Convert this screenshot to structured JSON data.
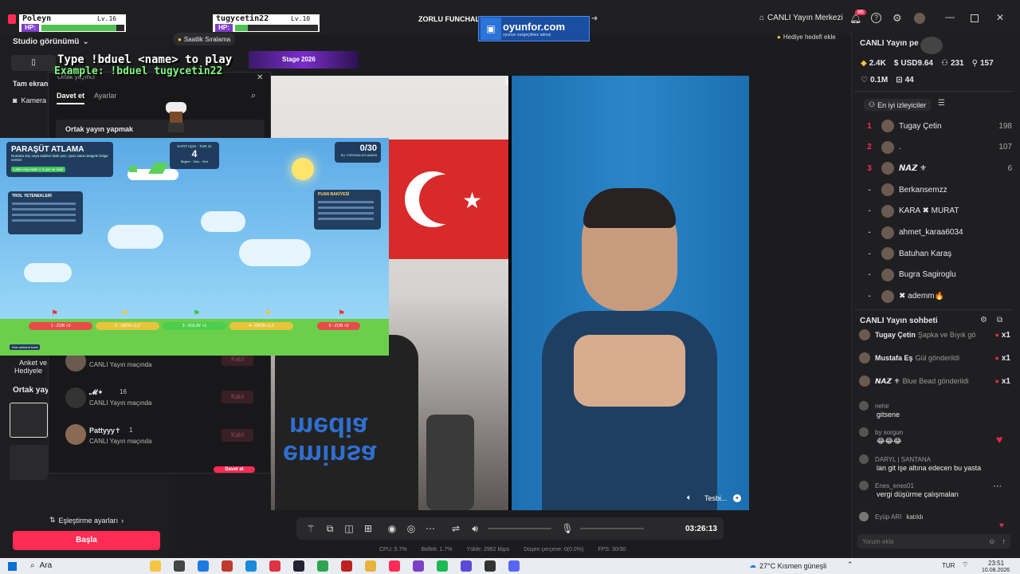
{
  "window": {
    "title": "ZORLU FUNCHAL",
    "live_center": "CANLI Yayın Merkezi",
    "notif_count": "86"
  },
  "players": [
    {
      "name": "Poleyn",
      "level": "Lv.16",
      "hp_label": "HP:",
      "hp_fraction": 0.9
    },
    {
      "name": "tugycetin22",
      "level": "Lv.10",
      "hp_label": "HP:",
      "hp_fraction": 0.15
    }
  ],
  "overlay": {
    "duel_line1": "Type !bduel <name> to play",
    "duel_line2": "Example: !bduel tugycetin22",
    "sponsor_name": "oyunfor.com",
    "sponsor_tag": "oyunun vazgeçilmez adresi",
    "hourly_rank": "Saatlik Sıralama",
    "gift_goal": "Hediye hedefi ekle",
    "stage_text": "Stage 2026"
  },
  "left_panel": {
    "studio_view": "Studio görünümü",
    "full_screen": "Tam ekran",
    "camera": "Kamera",
    "poll": "Anket ve",
    "gift": "Hediyele",
    "coop": "Ortak yay",
    "matching_settings": "Eşleştirme ayarları",
    "start": "Başla"
  },
  "cohost_popup": {
    "title": "Ortak yayıncı",
    "tabs": [
      "Davet et",
      "Ayarlar"
    ],
    "section": "Ortak yayın yapmak",
    "users": [
      {
        "name": "",
        "status": "CANLI Yayın maçında",
        "action": "Katıl"
      },
      {
        "name": "𝓜✦",
        "badge": "16",
        "status": "CANLI Yayın maçında",
        "action": "Katıl"
      },
      {
        "name": "Pattyyy✝",
        "badge": "1",
        "status": "CANLI Yayın maçında",
        "action": "Katıl"
      }
    ],
    "invite": "Davet et"
  },
  "game": {
    "title": "PARAŞÜT ATLAMA",
    "subtitle": "Numara seç veya sadece latte yaz; oyun sana rastgele bölge versin!",
    "hint": "Latte veya latte 1-3 yaz ve katıl",
    "round_label": "KATIT AÇIK · TUR 11",
    "round_number": "4",
    "round_sub": "Bilgiler · Solu · Sert",
    "score": "0/30",
    "score_sub": "SU YORGANI ATLAMASI",
    "troll_title": "TROL YETENEKLERİ",
    "points_title": "PUAN BAKİYESİ",
    "lanes": [
      "1 - ZOR ×3",
      "2 - ORTA ×1.2",
      "3 - KOLAY ×1",
      "4 - ORTA ×1.2",
      "5 - ZOR ×3"
    ],
    "footer": "Kick ambient boldi"
  },
  "stream": {
    "banner_words": [
      "media",
      "eminsa"
    ],
    "tesbih": "Tesbi..."
  },
  "controls": {
    "timer": "03:26:13"
  },
  "stats": {
    "cpu": "CPU: 5.7%",
    "memory": "Bellek: 1.7%",
    "upload": "Yükle: 2962 kbps",
    "dropped": "Düşen çerçeve: 0(0.0%)",
    "fps": "FPS: 30/30"
  },
  "right": {
    "title": "CANLI Yayın pe",
    "stats": [
      {
        "icon": "diamond-icon",
        "value": "2.4K"
      },
      {
        "icon": "dollar-icon",
        "value": "USD9.64"
      },
      {
        "icon": "people-icon",
        "value": "231"
      },
      {
        "icon": "viewer-icon",
        "value": "157"
      },
      {
        "icon": "heart-icon",
        "value": "0.1M"
      },
      {
        "icon": "gift-box-icon",
        "value": "44"
      }
    ],
    "top_viewers": "En iyi izleyiciler",
    "leaderboard": [
      {
        "rank": "1",
        "name": "Tugay Çetin",
        "score": "198"
      },
      {
        "rank": "2",
        "name": ".",
        "score": "107"
      },
      {
        "rank": "3",
        "name": "𝙉𝘼𝙕 ⚜",
        "score": "6"
      },
      {
        "rank": "-",
        "name": "Berkansemzz",
        "score": ""
      },
      {
        "rank": "-",
        "name": "KARA ✖ MURAT",
        "score": ""
      },
      {
        "rank": "-",
        "name": "ahmet_karaa6034",
        "score": ""
      },
      {
        "rank": "-",
        "name": "Batuhan Karaş",
        "score": ""
      },
      {
        "rank": "-",
        "name": "Bugra Sagiroglu",
        "score": ""
      },
      {
        "rank": "-",
        "name": "✖ ademm🔥",
        "score": ""
      }
    ],
    "chat_title": "CANLI Yayın sohbeti",
    "gifts": [
      {
        "user": "Tugay Çetin",
        "text": "Şapka ve Bıyık gö",
        "count": "x1"
      },
      {
        "user": "Mustafa Eş",
        "text": "Gül gönderildi",
        "count": "x1"
      },
      {
        "user": "𝙉𝘼𝙕 ⚜",
        "text": "Blue Bead gönderildi",
        "count": "x1"
      }
    ],
    "messages": [
      {
        "user": "nehir",
        "text": "gitsene"
      },
      {
        "user": "by sorgun",
        "text": "😂😂😂"
      },
      {
        "user": "DARYL | SANTANA",
        "text": "lan git işe altına edecen bu yasta"
      },
      {
        "user": "Enes_enes01",
        "text": "vergi düşürme çalışmaları"
      },
      {
        "user": "Eyüp ARI",
        "text": "katıldı"
      }
    ],
    "comment_placeholder": "Yorum ekle"
  },
  "taskbar": {
    "search": "Ara",
    "weather": "27°C  Kısmen güneşli",
    "lang": "TUR",
    "time": "23:51",
    "date": "10.08.2026"
  }
}
